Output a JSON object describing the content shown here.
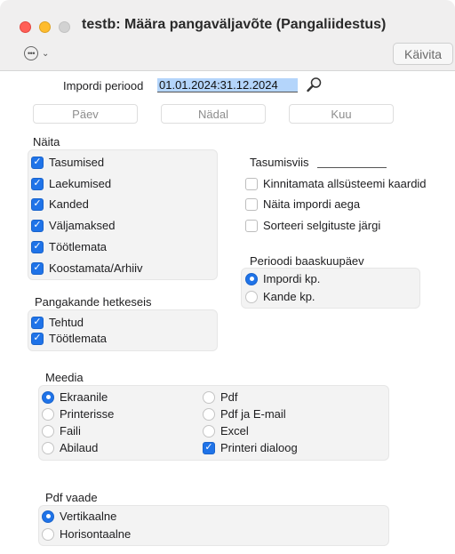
{
  "window": {
    "title": "testb: Määra pangaväljavõte (Pangaliidestus)"
  },
  "toolbar": {
    "more_glyph": "•••",
    "chevron": "⌄",
    "run_label": "Käivita"
  },
  "period": {
    "label": "Impordi periood",
    "value": "01.01.2024:31.12.2024"
  },
  "segments": {
    "day": "Päev",
    "week": "Nädal",
    "month": "Kuu"
  },
  "show": {
    "label": "Näita",
    "items": [
      {
        "label": "Tasumised",
        "checked": true
      },
      {
        "label": "Laekumised",
        "checked": true
      },
      {
        "label": "Kanded",
        "checked": true
      },
      {
        "label": "Väljamaksed",
        "checked": true
      },
      {
        "label": "Töötlemata",
        "checked": true
      },
      {
        "label": "Koostamata/Arhiiv",
        "checked": true
      }
    ]
  },
  "payment_ref": {
    "label": "Tasumisviis",
    "value": ""
  },
  "options": {
    "items": [
      {
        "label": "Kinnitamata allsüsteemi kaardid",
        "checked": false
      },
      {
        "label": "Näita impordi aega",
        "checked": false
      },
      {
        "label": "Sorteeri selgituste järgi",
        "checked": false
      }
    ]
  },
  "base_date": {
    "label": "Perioodi baaskuupäev",
    "items": [
      {
        "label": "Impordi kp.",
        "selected": true
      },
      {
        "label": "Kande kp.",
        "selected": false
      }
    ]
  },
  "bank_once": {
    "label": "Pangakande hetkeseis",
    "items": [
      {
        "label": "Tehtud",
        "checked": true
      },
      {
        "label": "Töötlemata",
        "checked": true
      }
    ]
  },
  "media": {
    "label": "Meedia",
    "left": [
      {
        "label": "Ekraanile",
        "selected": true
      },
      {
        "label": "Printerisse",
        "selected": false
      },
      {
        "label": "Faili",
        "selected": false
      },
      {
        "label": "Abilaud",
        "selected": false
      }
    ],
    "right": [
      {
        "label": "Pdf",
        "type": "radio",
        "selected": false
      },
      {
        "label": "Pdf ja E-mail",
        "type": "radio",
        "selected": false
      },
      {
        "label": "Excel",
        "type": "radio",
        "selected": false
      },
      {
        "label": "Printeri dialoog",
        "type": "checkbox",
        "selected": true
      }
    ]
  },
  "pdf_view": {
    "label": "Pdf vaade",
    "items": [
      {
        "label": "Vertikaalne",
        "selected": true
      },
      {
        "label": "Horisontaalne",
        "selected": false
      }
    ]
  },
  "colors": {
    "accent": "#1f73e8",
    "selection": "#b4d5fb",
    "group_bg": "#f3f3f3"
  }
}
